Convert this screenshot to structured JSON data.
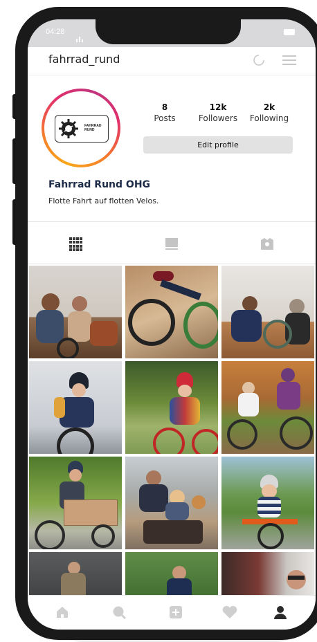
{
  "status_bar": {
    "time": "04:28"
  },
  "header": {
    "username": "fahrrad_rund"
  },
  "profile": {
    "logo_line1": "FAHRRAD",
    "logo_line2": "RUND",
    "stats": [
      {
        "value": "8",
        "label": "Posts"
      },
      {
        "value": "12k",
        "label": "Followers"
      },
      {
        "value": "2k",
        "label": "Following"
      }
    ],
    "edit_label": "Edit profile",
    "name": "Fahrrad Rund OHG",
    "bio": "Flotte Fahrt auf flotten Velos."
  },
  "tabs": [
    "grid-tab",
    "feed-tab",
    "tagged-tab"
  ],
  "colors": {
    "name_text": "#1c2b48",
    "accent_gradient": [
      "#f9a81b",
      "#e1306c"
    ],
    "icon_grey": "#c8c8c8"
  },
  "bottom_nav": [
    "home-icon",
    "search-icon",
    "add-icon",
    "heart-icon",
    "profile-icon"
  ]
}
